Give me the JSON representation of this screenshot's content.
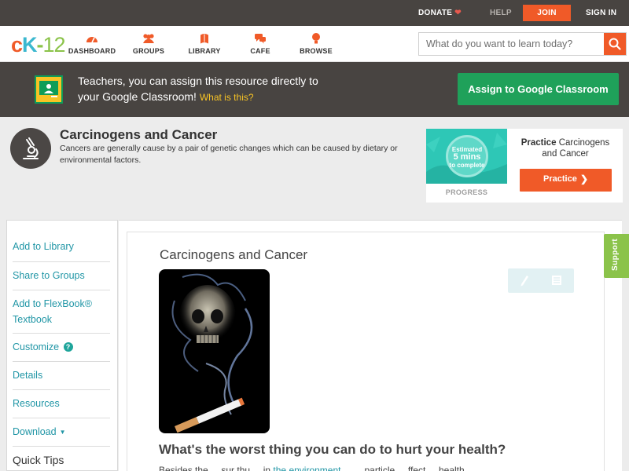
{
  "topbar": {
    "donate": "DONATE",
    "help": "HELP",
    "join": "JOIN",
    "signin": "SIGN IN"
  },
  "logo": {
    "c": "c",
    "k": "K",
    "dash": "-",
    "num": "12"
  },
  "nav": {
    "items": [
      {
        "label": "DASHBOARD",
        "icon": "dashboard-icon"
      },
      {
        "label": "GROUPS",
        "icon": "groups-icon"
      },
      {
        "label": "LIBRARY",
        "icon": "library-icon"
      },
      {
        "label": "CAFE",
        "icon": "cafe-icon"
      },
      {
        "label": "BROWSE",
        "icon": "browse-icon"
      }
    ],
    "search_placeholder": "What do you want to learn today?"
  },
  "classroom_banner": {
    "line1": "Teachers, you can assign this resource directly to",
    "line2": "your Google Classroom!",
    "what_is_this": "What is this?",
    "button": "Assign to Google Classroom"
  },
  "concept": {
    "title": "Carcinogens and Cancer",
    "description": "Cancers are generally cause by a pair of genetic changes which can be caused by dietary or environmental factors."
  },
  "practice": {
    "estimated": "Estimated",
    "mins": "5 mins",
    "to_complete": "to complete",
    "progress": "PROGRESS",
    "heading_bold": "Practice",
    "heading_rest": "Carcinogens and Cancer",
    "button": "Practice"
  },
  "sidebar": {
    "items": [
      "Add to Library",
      "Share to Groups",
      "Add to FlexBook®",
      "Textbook",
      "Customize",
      "Details",
      "Resources",
      "Download"
    ],
    "quick_tips": "Quick Tips"
  },
  "article": {
    "title": "Carcinogens and Cancer",
    "question": "What's the worst thing you can do to hurt your health?",
    "body_start": "Besides the ... sur thu ... in",
    "body_link": "the environment",
    "body_end": "... ... particle ... ffect ... health"
  },
  "support": "Support",
  "colors": {
    "accent": "#f05a28",
    "teal": "#2196a6",
    "green": "#1fa15a",
    "dark": "#484441"
  }
}
